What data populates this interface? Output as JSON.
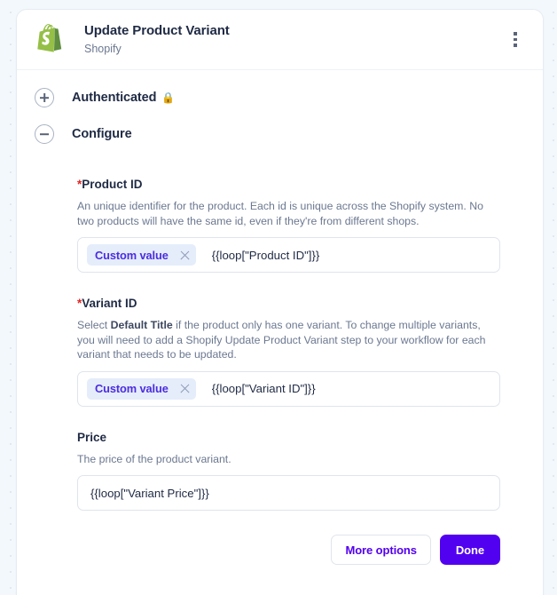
{
  "header": {
    "title": "Update Product Variant",
    "subtitle": "Shopify",
    "logo_icon": "shopify-bag-icon",
    "menu_icon": "kebab-menu-icon"
  },
  "sections": [
    {
      "label": "Authenticated",
      "state_icon": "plus-circle-icon",
      "expanded": false,
      "badge_icon": "lock-icon",
      "badge_glyph": "🔒"
    },
    {
      "label": "Configure",
      "state_icon": "minus-circle-icon",
      "expanded": true
    }
  ],
  "fields": [
    {
      "label": "Product ID",
      "required": true,
      "required_marker": "*",
      "description": "An unique identifier for the product. Each id is unique across the Shopify system. No two products will have the same id, even if they're from different shops.",
      "chip_label": "Custom value",
      "chip_remove_icon": "close-icon",
      "value": "{{loop[\"Product ID\"]}}"
    },
    {
      "label": "Variant ID",
      "required": true,
      "required_marker": "*",
      "description_pre": "Select ",
      "description_bold": "Default Title",
      "description_post": " if the product only has one variant. To change multiple variants, you will need to add a Shopify Update Product Variant step to your workflow for each variant that needs to be updated.",
      "chip_label": "Custom value",
      "chip_remove_icon": "close-icon",
      "value": "{{loop[\"Variant ID\"]}}"
    },
    {
      "label": "Price",
      "required": false,
      "description": "The price of the product variant.",
      "value": "{{loop[\"Variant Price\"]}}"
    }
  ],
  "footer": {
    "more_options_label": "More options",
    "done_label": "Done"
  },
  "colors": {
    "accent_purple": "#5200f0",
    "chip_bg": "#e5edfb",
    "chip_text": "#4b2de0",
    "required_red": "#e02424",
    "shopify_green_light": "#95bf47",
    "shopify_green_dark": "#5e8e3e",
    "page_bg": "#f3f8fc"
  }
}
